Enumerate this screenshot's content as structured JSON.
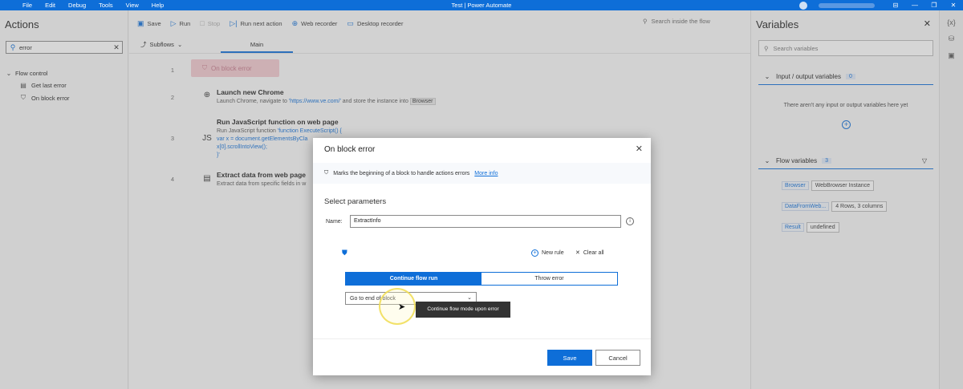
{
  "titlebar": {
    "menu": [
      "File",
      "Edit",
      "Debug",
      "Tools",
      "View",
      "Help"
    ],
    "title": "Test | Power Automate",
    "controls": [
      "⊟",
      "—",
      "❐",
      "✕"
    ]
  },
  "actions_pane": {
    "title": "Actions",
    "search_value": "error",
    "group": "Flow control",
    "items": [
      "Get last error",
      "On block error"
    ]
  },
  "toolbar": {
    "save": "Save",
    "run": "Run",
    "stop": "Stop",
    "run_next": "Run next action",
    "web_recorder": "Web recorder",
    "desktop_recorder": "Desktop recorder",
    "search_flow": "Search inside the flow"
  },
  "tabs": {
    "subflows": "Subflows",
    "main": "Main"
  },
  "steps": [
    {
      "num": "1",
      "title": "On block error"
    },
    {
      "num": "2",
      "title": "Launch new Chrome",
      "desc_a": "Launch Chrome, navigate to ",
      "desc_url": "'https://www.ve.com/'",
      "desc_b": " and store the instance into ",
      "desc_var": "Browser"
    },
    {
      "num": "3",
      "title": "Run JavaScript function on web page",
      "desc_a": "Run JavaScript function ",
      "desc_fn": "'function ExecuteScript() {",
      "desc_line2": "var x = document.getElementsByCla",
      "desc_line3": "x[0].scrollIntoView();",
      "desc_line4": "}'"
    },
    {
      "num": "4",
      "title": "Extract data from web page",
      "desc_a": "Extract data from specific fields in w"
    }
  ],
  "variables_pane": {
    "title": "Variables",
    "search_placeholder": "Search variables",
    "io_section": "Input / output variables",
    "io_count": "0",
    "io_empty": "There aren't any input or output variables here yet",
    "flow_section": "Flow variables",
    "flow_count": "3",
    "vars": [
      {
        "name": "Browser",
        "value": "WebBrowser Instance"
      },
      {
        "name": "DataFromWeb...",
        "value": "4 Rows, 3 columns"
      },
      {
        "name": "Result",
        "value": "undefined"
      }
    ]
  },
  "modal": {
    "title": "On block error",
    "info": "Marks the beginning of a block to handle actions errors",
    "more_info": "More info",
    "subtitle": "Select parameters",
    "name_label": "Name:",
    "name_value": "ExtractInfo",
    "new_rule": "New rule",
    "clear_all": "Clear all",
    "seg_continue": "Continue flow run",
    "seg_throw": "Throw error",
    "select_value": "Go to end of block",
    "tooltip": "Continue flow mode upon error",
    "save": "Save",
    "cancel": "Cancel"
  },
  "colors": {
    "accent": "#0e6ed8",
    "block_highlight": "#f3c9cf"
  }
}
